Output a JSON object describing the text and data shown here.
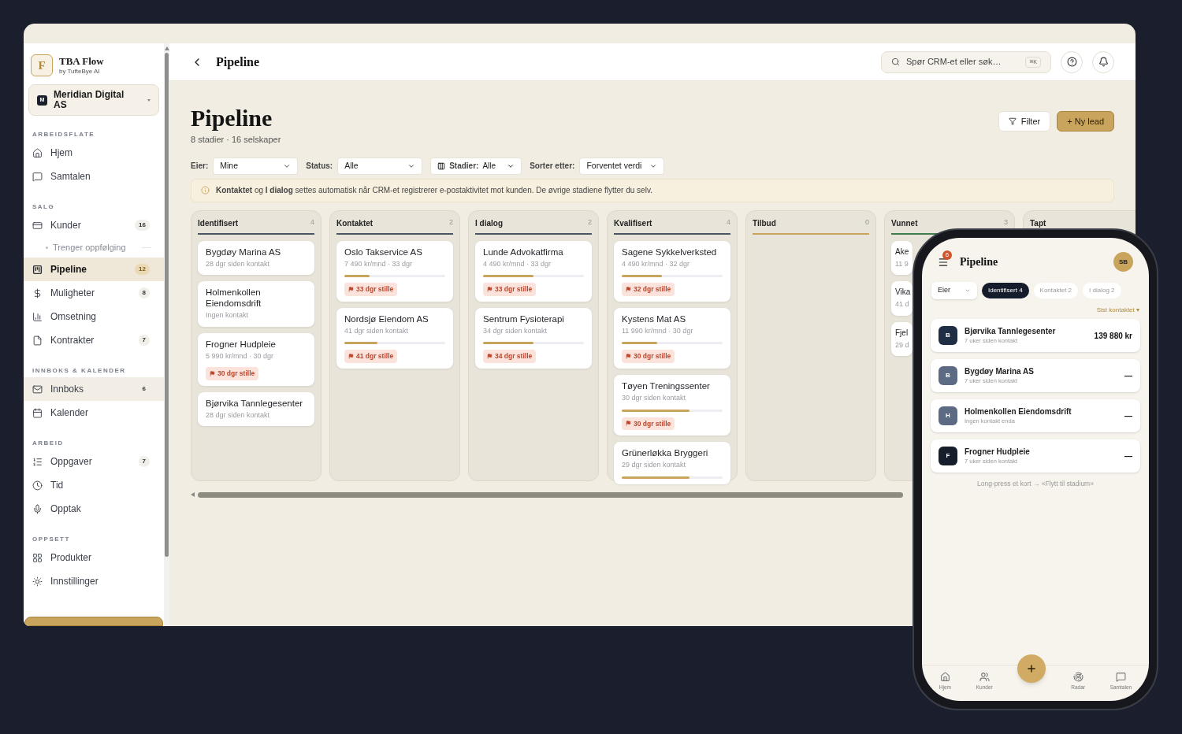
{
  "sidebar": {
    "logo": {
      "letter": "F",
      "name": "TBA Flow",
      "byline": "by TufteBye AI"
    },
    "workspace": {
      "letter": "M",
      "name": "Meridian Digital AS"
    },
    "sections": [
      {
        "title": "ARBEIDSFLATE",
        "items": [
          {
            "kind": "item",
            "label": "Hjem",
            "selected": false,
            "highlighted": false
          },
          {
            "kind": "item",
            "label": "Samtalen",
            "selected": false,
            "highlighted": false
          }
        ]
      },
      {
        "title": "SALG",
        "items": [
          {
            "kind": "item",
            "label": "Kunder",
            "count": "16",
            "selected": false,
            "highlighted": false
          },
          {
            "kind": "subitem",
            "label": "Trenger oppfølging",
            "selected": false,
            "highlighted": false
          },
          {
            "kind": "item",
            "label": "Pipeline",
            "count": "12",
            "selected": true,
            "highlighted": false
          },
          {
            "kind": "item",
            "label": "Muligheter",
            "count": "8",
            "selected": false,
            "highlighted": false
          },
          {
            "kind": "item",
            "label": "Omsetning",
            "selected": false,
            "highlighted": false
          },
          {
            "kind": "item",
            "label": "Kontrakter",
            "count": "7",
            "selected": false,
            "highlighted": false
          }
        ]
      },
      {
        "title": "INNBOKS & KALENDER",
        "items": [
          {
            "kind": "item",
            "label": "Innboks",
            "count": "6",
            "selected": false,
            "highlighted": true
          },
          {
            "kind": "item",
            "label": "Kalender",
            "selected": false,
            "highlighted": false
          }
        ]
      },
      {
        "title": "ARBEID",
        "items": [
          {
            "kind": "item",
            "label": "Oppgaver",
            "count": "7",
            "selected": false,
            "highlighted": false
          },
          {
            "kind": "item",
            "label": "Tid",
            "selected": false,
            "highlighted": false
          },
          {
            "kind": "item",
            "label": "Opptak",
            "selected": false,
            "highlighted": false
          }
        ]
      },
      {
        "title": "OPPSETT",
        "items": [
          {
            "kind": "item",
            "label": "Produkter",
            "selected": false,
            "highlighted": false
          },
          {
            "kind": "item",
            "label": "Innstillinger",
            "selected": false,
            "highlighted": false
          }
        ]
      }
    ]
  },
  "topbar": {
    "title": "Pipeline",
    "search": {
      "placeholder": "Spør CRM-et eller søk…",
      "shortcut": "⌘K"
    }
  },
  "header": {
    "title": "Pipeline",
    "subtitle": "8 stadier · 16 selskaper",
    "filter_button": "Filter",
    "new_button": "+ Ny lead"
  },
  "filters": [
    {
      "kind": "select",
      "label": "Eier:",
      "value": "Mine"
    },
    {
      "kind": "select",
      "label": "Status:",
      "value": "Alle"
    },
    {
      "kind": "columns",
      "label": "Stadier:",
      "value": "Alle"
    },
    {
      "kind": "select",
      "label": "Sorter etter:",
      "value": "Forventet verdi"
    }
  ],
  "notice": "**Kontaktet** og **I dialog** settes automatisk når CRM-et registrerer e-postaktivitet mot kunden. De øvrige stadiene flytter du selv.",
  "columns": [
    {
      "title": "Identifisert",
      "count": "4",
      "color": "#4b5563",
      "cards": [
        {
          "name": "Bygdøy Marina AS",
          "meta": "28 dgr siden kontakt"
        },
        {
          "name": "Holmenkollen Eiendomsdrift",
          "meta": "Ingen kontakt"
        },
        {
          "name": "Frogner Hudpleie",
          "meta": "5 990 kr/mnd · 30 dgr",
          "flag": "30 dgr stille"
        },
        {
          "name": "Bjørvika Tannlegesenter",
          "meta": "28 dgr siden kontakt"
        }
      ]
    },
    {
      "title": "Kontaktet",
      "count": "2",
      "color": "#4b5563",
      "cards": [
        {
          "name": "Oslo Takservice AS",
          "meta": "7 490 kr/mnd · 33 dgr",
          "level": 0.25,
          "flag": "33 dgr stille"
        },
        {
          "name": "Nordsjø Eiendom AS",
          "meta": "41 dgr siden kontakt",
          "level": 0.33,
          "flag": "41 dgr stille"
        }
      ]
    },
    {
      "title": "I dialog",
      "count": "2",
      "color": "#4b5563",
      "cards": [
        {
          "name": "Lunde Advokatfirma",
          "meta": "4 490 kr/mnd · 33 dgr",
          "level": 0.5,
          "flag": "33 dgr stille"
        },
        {
          "name": "Sentrum Fysioterapi",
          "meta": "34 dgr siden kontakt",
          "level": 0.5,
          "flag": "34 dgr stille"
        }
      ]
    },
    {
      "title": "Kvalifisert",
      "count": "4",
      "color": "#4b5563",
      "cards": [
        {
          "name": "Sagene Sykkelverksted",
          "meta": "4 490 kr/mnd · 32 dgr",
          "level": 0.4,
          "flag": "32 dgr stille"
        },
        {
          "name": "Kystens Mat AS",
          "meta": "11 990 kr/mnd · 30 dgr",
          "level": 0.35,
          "flag": "30 dgr stille"
        },
        {
          "name": "Tøyen Treningssenter",
          "meta": "30 dgr siden kontakt",
          "level": 0.67,
          "flag": "30 dgr stille"
        },
        {
          "name": "Grünerløkka Bryggeri",
          "meta": "29 dgr siden kontakt",
          "level": 0.67
        }
      ]
    },
    {
      "title": "Tilbud",
      "count": "0",
      "color": "#c9a45c"
    },
    {
      "title": "Vunnet",
      "count": "3",
      "color": "#3f7d4e",
      "cards": [
        {
          "name": "Ake",
          "meta": "11 9"
        },
        {
          "name": "Vika",
          "meta": "41 d"
        },
        {
          "name": "Fjel",
          "meta": "29 d"
        }
      ]
    },
    {
      "title": "Tapt"
    }
  ],
  "phone": {
    "menu_badge": "6",
    "title": "Pipeline",
    "avatar": "SB",
    "owner_select": "Eier",
    "chips": [
      {
        "label": "Identifisert 4",
        "selected": true
      },
      {
        "label": "Kontaktet 2",
        "selected": false
      },
      {
        "label": "I dialog 2",
        "selected": false
      }
    ],
    "sort": "Sist kontaktet ▾",
    "leads": [
      {
        "letter": "B",
        "color": "#1f2d45",
        "name": "Bjørvika Tannlegesenter",
        "meta": "7 uker siden kontakt",
        "value": "139 880 kr"
      },
      {
        "letter": "B",
        "color": "#5c6a84",
        "name": "Bygdøy Marina AS",
        "meta": "7 uker siden kontakt",
        "value": "—"
      },
      {
        "letter": "H",
        "color": "#5c6a84",
        "name": "Holmenkollen Eiendomsdrift",
        "meta": "Ingen kontakt enda",
        "value": "—"
      },
      {
        "letter": "F",
        "color": "#161e2c",
        "name": "Frogner Hudpleie",
        "meta": "7 uker siden kontakt",
        "value": "—"
      }
    ],
    "hint": "Long-press et kort → «Flytt til stadium»",
    "nav": [
      {
        "kind": "home",
        "label": "Hjem"
      },
      {
        "kind": "people",
        "label": "Kunder"
      },
      {
        "kind": "add"
      },
      {
        "kind": "radar",
        "label": "Radar"
      },
      {
        "kind": "chat",
        "label": "Samtalen"
      }
    ]
  }
}
